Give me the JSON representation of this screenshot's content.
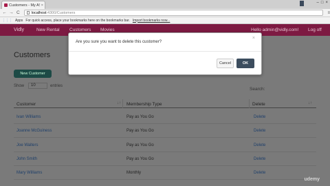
{
  "browser": {
    "tab_title": "Customers - My ASP.",
    "tab_close": "×",
    "user_chip": "",
    "win_buttons": [
      "–",
      "□",
      "×"
    ],
    "nav_back": "←",
    "nav_forward": "→",
    "nav_reload": "C",
    "url_host": "localhost",
    "url_path": ":4300/Customers",
    "menu_icon": "≡",
    "apps_icon": "⋮⋮⋮",
    "apps_label": "Apps",
    "bookmarks_hint": "For quick access, place your bookmarks here on the bookmarks bar.",
    "bookmarks_import": "Import bookmarks now..."
  },
  "navbar": {
    "brand": "Vidly",
    "links": [
      "New Rental",
      "Customers",
      "Movies"
    ],
    "user_greeting": "Hello admin@vidly.com!",
    "logoff": "Log off"
  },
  "page": {
    "title": "Customers",
    "new_button": "New Customer",
    "show_label": "Show",
    "show_value": "10",
    "entries_label": "entries",
    "search_label": "Search:"
  },
  "table": {
    "headers": [
      "Customer",
      "Membership Type",
      "Delete"
    ],
    "sort_icons": [
      "↓↑",
      "↓↑",
      "↓↑"
    ],
    "rows": [
      {
        "name": "Ivan Williams",
        "type": "Pay as You Go",
        "delete": "Delete"
      },
      {
        "name": "Joanne McGuiness",
        "type": "Pay as You Go",
        "delete": "Delete"
      },
      {
        "name": "Joe Walters",
        "type": "Pay as You Go",
        "delete": "Delete"
      },
      {
        "name": "John Smith",
        "type": "Pay as You Go",
        "delete": "Delete"
      },
      {
        "name": "Mary Williams",
        "type": "Monthly",
        "delete": "Delete"
      }
    ]
  },
  "modal": {
    "message": "Are you sure you want to delete this customer?",
    "close_icon": "×",
    "cancel_label": "Cancel",
    "ok_label": "OK"
  },
  "watermark": "udemy",
  "colors": {
    "navbar": "#7d1a42",
    "primary_button": "#1d4a46",
    "ok_button": "#3c4d5e",
    "overlay": "#7a7a7a"
  }
}
